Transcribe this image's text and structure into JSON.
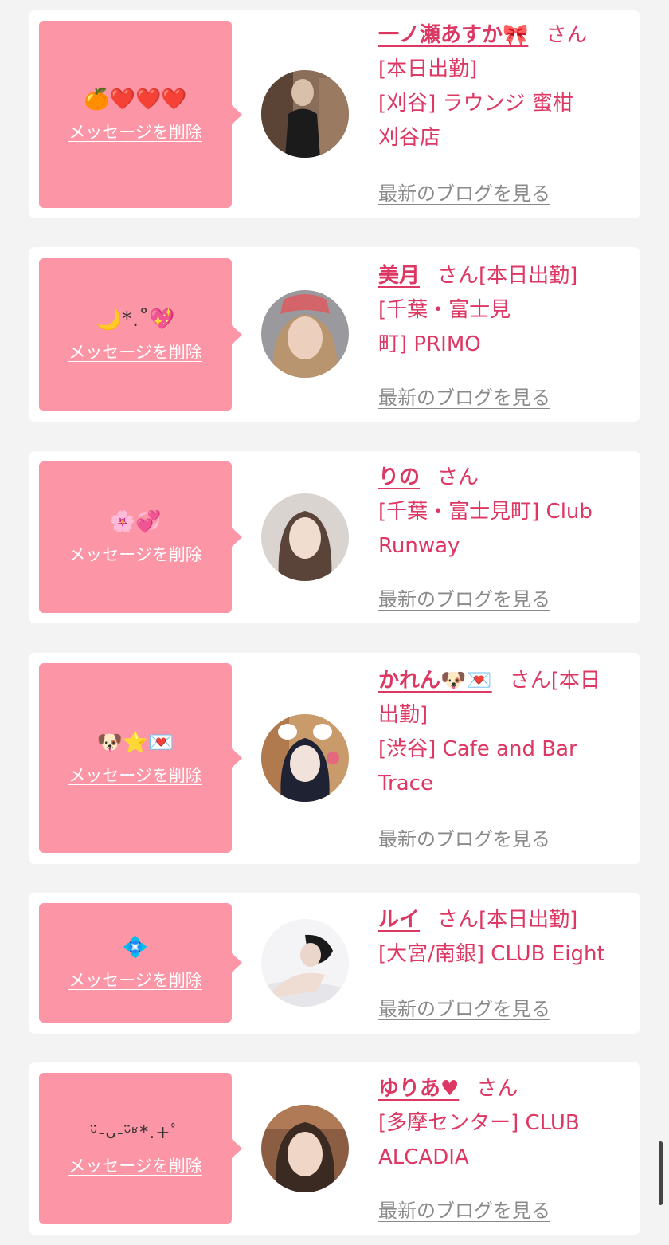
{
  "entries": [
    {
      "message": "🍊❤️❤️❤️",
      "delete_label": "メッセージを削除",
      "name": "一ノ瀬あすか🎀",
      "suffix": "さん",
      "lines": [
        "[本日出勤]",
        "[刈谷] ラウンジ 蜜柑",
        "刈谷店"
      ],
      "blog_label": "最新のブログを見る",
      "avatar_icon": "profile-photo"
    },
    {
      "message": "🌙*.˚💖",
      "delete_label": "メッセージを削除",
      "name": "美月",
      "suffix": "さん[本日出勤]",
      "lines": [
        "[千葉・富士見",
        "町] PRIMO"
      ],
      "blog_label": "最新のブログを見る",
      "avatar_icon": "profile-photo"
    },
    {
      "message": "🌸💞",
      "delete_label": "メッセージを削除",
      "name": "りの",
      "suffix": "さん",
      "lines": [
        "[千葉・富士見町] Club",
        "Runway"
      ],
      "blog_label": "最新のブログを見る",
      "avatar_icon": "profile-photo"
    },
    {
      "message": "🐶⭐💌",
      "delete_label": "メッセージを削除",
      "name": "かれん🐶💌",
      "suffix": "さん[本日",
      "lines": [
        "出勤]",
        "[渋谷] Cafe and Bar",
        "Trace"
      ],
      "blog_label": "最新のブログを見る",
      "avatar_icon": "profile-photo"
    },
    {
      "message": "💠",
      "delete_label": "メッセージを削除",
      "name": "ルイ",
      "suffix": "さん[本日出勤]",
      "lines": [
        "[大宮/南銀] CLUB Eight"
      ],
      "blog_label": "最新のブログを見る",
      "avatar_icon": "profile-photo"
    },
    {
      "message": "ᵕ̈-ᴗ-ᵕ̈ʶ*.+ﾟ",
      "delete_label": "メッセージを削除",
      "name": "ゆりあ♥",
      "suffix": "さん",
      "lines": [
        "[多摩センター] CLUB",
        "ALCADIA"
      ],
      "blog_label": "最新のブログを見る",
      "avatar_icon": "profile-photo"
    }
  ],
  "colors": {
    "accent": "#dd3763",
    "bubble": "#fc95a6",
    "background": "#f3f3f3",
    "link_gray": "#8a8a8a"
  }
}
